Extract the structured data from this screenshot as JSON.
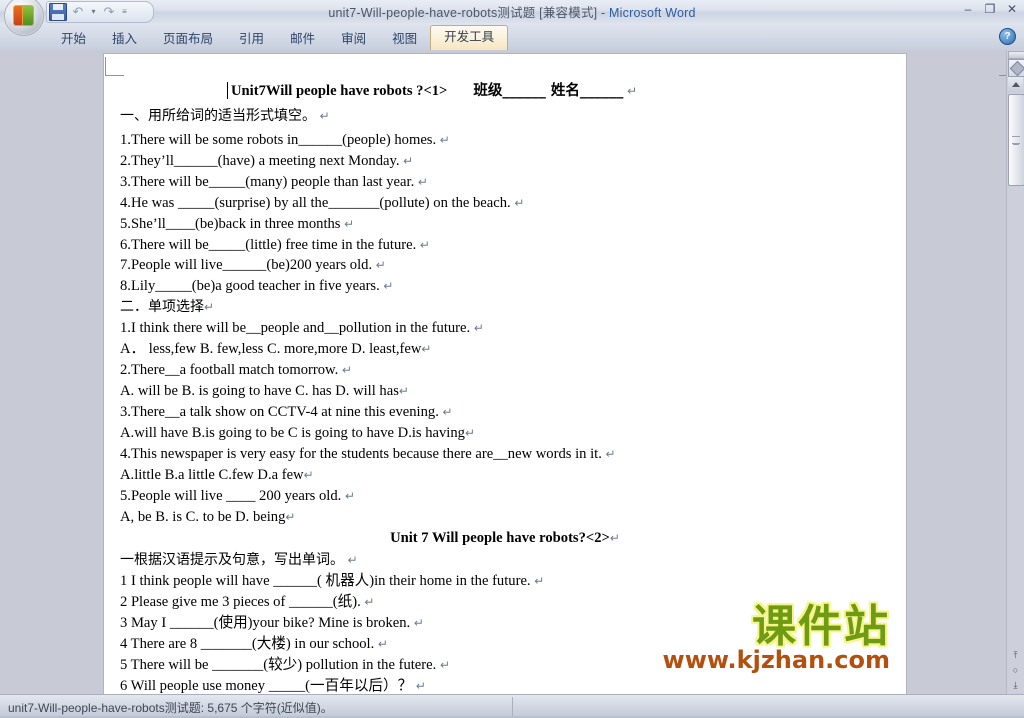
{
  "window": {
    "title_doc": "unit7-Will-people-have-robots测试题",
    "title_mode": " [兼容模式]",
    "title_sep": " - ",
    "title_app": "Microsoft Word",
    "minimize": "–",
    "restore": "❐",
    "close": "✕"
  },
  "quick_access": {
    "save_icon": "save-icon",
    "undo_icon": "undo-icon",
    "undo_caret": "▾",
    "redo_icon": "redo-icon",
    "customize_caret": "═"
  },
  "ribbon": {
    "tabs": [
      {
        "label": "开始",
        "active": false
      },
      {
        "label": "插入",
        "active": false
      },
      {
        "label": "页面布局",
        "active": false
      },
      {
        "label": "引用",
        "active": false
      },
      {
        "label": "邮件",
        "active": false
      },
      {
        "label": "审阅",
        "active": false
      },
      {
        "label": "视图",
        "active": false
      },
      {
        "label": "开发工具",
        "active": true
      }
    ],
    "help_label": "?"
  },
  "document": {
    "title_1": "Unit7Will people have robots ?<1>",
    "title_1_fields": "班级______   姓名______",
    "section_1_heading": "一、用所给词的适当形式填空。",
    "section_1_items": [
      "1.There will be some robots in______(people) homes.",
      "2.They’ll______(have) a meeting next Monday.",
      "3.There will be_____(many) people than last year.",
      "4.He was _____(surprise) by all the_______(pollute) on the beach.",
      "5.She’ll____(be)back in three months",
      "6.There will be_____(little) free time in the future.",
      "7.People will live______(be)200 years old.",
      "8.Lily_____(be)a good teacher in five years."
    ],
    "section_2_heading": "二．单项选择",
    "section_2_items": [
      {
        "q": "1.I think there will be__people and__pollution in the future.",
        "a": "A． less,few      B. few,less       C. more,more        D. least,few"
      },
      {
        "q": "2.There__a football match tomorrow.",
        "a": "A. will be        B. is going to have       C. has        D. will has"
      },
      {
        "q": "3.There__a talk show on CCTV-4 at nine this evening.",
        "a": "A.will have     B.is going to be     C is going to have     D.is having"
      },
      {
        "q": "4.This newspaper is very easy for the students because there are__new words in it.",
        "a": "A.little         B.a little       C.few       D.a few"
      },
      {
        "q": "5.People will live ____ 200 years old.",
        "a": "A, be          B. is           C. to be     D. being"
      }
    ],
    "title_2": "Unit 7 Will people have robots?<2>",
    "section_3_heading": "一根据汉语提示及句意，写出单词。",
    "section_3_items": [
      "1  I   think people will   have   ______( 机器人)in   their   home in the future.",
      "2 Please   give   me 3   pieces   of   ______(纸).",
      "3 May I ______(使用)your bike?   Mine  is   broken.",
      "4 There are 8 _______(大楼)   in our school.",
      "5 There   will be    _______(较少) pollution in the futere.",
      "6 Will   people use   money   _____(一百年以后）？"
    ],
    "pilcrow": "↵"
  },
  "watermark": {
    "brand": "课件站",
    "url": "www.kjzhan.com",
    "brand_color": "#6f9a13",
    "url_color": "#b4500f"
  },
  "scrollbar": {
    "split_handle": "split-handle",
    "select_browse_object": "select-browse-object-icon",
    "up_arrow": "scroll-up-icon",
    "prev_page": "⤒",
    "browse_circle": "○",
    "next_page": "⤓"
  },
  "statusbar": {
    "text": "unit7-Will-people-have-robots测试题: 5,675 个字符(近似值)。"
  }
}
